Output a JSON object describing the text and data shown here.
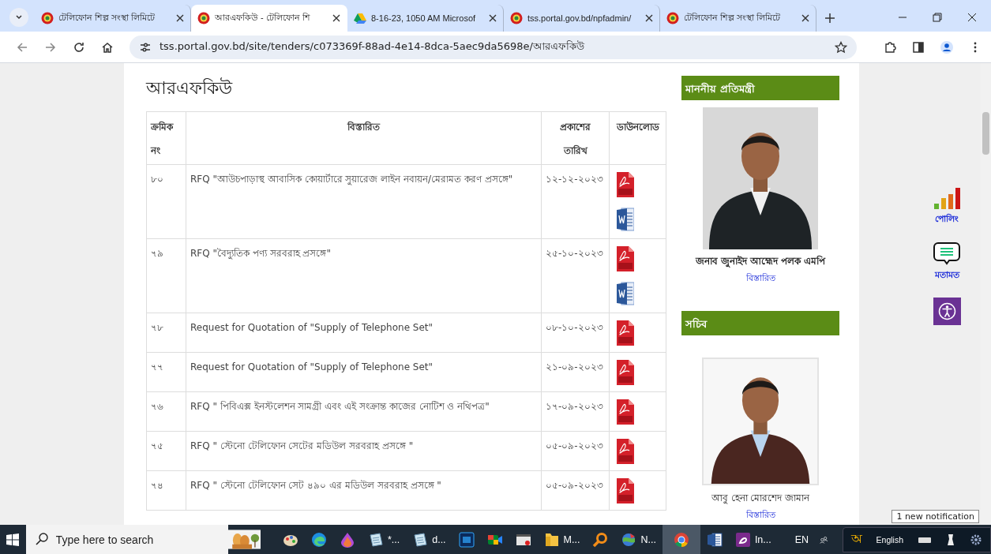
{
  "browser": {
    "tabs": [
      {
        "title": "টেলিফোন শিল্প সংস্থা লিমিটে",
        "kind": "emblem",
        "selected": false
      },
      {
        "title": "আরএফকিউ - টেলিফোন শি",
        "kind": "emblem",
        "selected": true
      },
      {
        "title": "8-16-23, 1050 AM Microsof",
        "kind": "drive",
        "selected": false
      },
      {
        "title": "tss.portal.gov.bd/npfadmin/",
        "kind": "emblem",
        "selected": false
      },
      {
        "title": "টেলিফোন শিল্প সংস্থা লিমিটে",
        "kind": "emblem",
        "selected": false
      }
    ],
    "url": "tss.portal.gov.bd/site/tenders/c073369f-88ad-4e14-8dca-5aec9da5698e/আরএফকিউ"
  },
  "page": {
    "heading": "আরএফকিউ",
    "table": {
      "columns": [
        {
          "lines": [
            "ক্রমিক",
            "নং"
          ]
        },
        {
          "lines": [
            "বিস্তারিত"
          ]
        },
        {
          "lines": [
            "প্রকাশের",
            "তারিখ"
          ]
        },
        {
          "lines": [
            "ডাউনলোড"
          ]
        }
      ],
      "rows": [
        {
          "no": "৮০",
          "details": "RFQ \"আউচপাড়াস্থ আবাসিক কোয়ার্টারে সুয়ারেজ লাইন নবায়ন/মেরামত করণ প্রসঙ্গে\"",
          "date": "১২-১২-২০২৩",
          "files": [
            {
              "kind": "pdf"
            },
            {
              "kind": "word"
            }
          ]
        },
        {
          "no": "৭৯",
          "details": "RFQ \"বৈদ্যুতিক পণ্য সরবরাহ প্রসঙ্গে\"",
          "date": "২৫-১০-২০২৩",
          "files": [
            {
              "kind": "pdf"
            },
            {
              "kind": "word"
            }
          ]
        },
        {
          "no": "৭৮",
          "details": "Request for Quotation of \"Supply of Telephone Set\"",
          "date": "০৮-১০-২০২৩",
          "files": [
            {
              "kind": "pdf"
            }
          ]
        },
        {
          "no": "৭৭",
          "details": "Request for Quotation of \"Supply of Telephone Set\"",
          "date": "২১-০৯-২০২৩",
          "files": [
            {
              "kind": "pdf"
            }
          ]
        },
        {
          "no": "৭৬",
          "details": "RFQ \"  পিবিএক্স ইনস্টলেশন সামগ্রী এবং এই  সংক্রান্ত  কাজের নোটিশ ও নথিপত্র\"",
          "date": "১৭-০৯-২০২৩",
          "files": [
            {
              "kind": "pdf"
            }
          ]
        },
        {
          "no": "৭৫",
          "details": "RFQ  \" স্টেনো টেলিফোন সেটের মডিউল সরবরাহ  প্রসঙ্গে \"",
          "date": "০৫-০৯-২০২৩",
          "files": [
            {
              "kind": "pdf"
            }
          ]
        },
        {
          "no": "৭৪",
          "details": "RFQ  \" স্টেনো টেলিফোন সেট ৪৯০ এর মডিউল সরবরাহ  প্রসঙ্গে \"",
          "date": "০৫-০৯-২০২৩",
          "files": [
            {
              "kind": "pdf"
            }
          ]
        }
      ]
    }
  },
  "sidebar": [
    {
      "heading": "মাননীয় প্রতিমন্ত্রী",
      "name": "জনাব জুনাইদ আহ্মেদ পলক এমপি",
      "link": "বিস্তারিত"
    },
    {
      "heading": "সচিব",
      "name": "আবু হেনা মোরশেদ জামান",
      "link": "বিস্তারিত"
    }
  ],
  "floating": [
    {
      "kind": "poll",
      "label": "পোলিং"
    },
    {
      "kind": "feedback",
      "label": "মতামত"
    },
    {
      "kind": "accessibility"
    }
  ],
  "notification": "1 new notification",
  "taskbar": {
    "search": {
      "placeholder": "Type here to search"
    },
    "apps": [
      {
        "kind": "paint",
        "selected": false
      },
      {
        "kind": "edge",
        "selected": false
      },
      {
        "kind": "drop",
        "selected": false
      },
      {
        "kind": "notepad",
        "label": "*...",
        "selected": false
      },
      {
        "kind": "notepad",
        "label": "d...",
        "selected": false
      },
      {
        "kind": "ps",
        "selected": false
      },
      {
        "kind": "meet",
        "selected": false
      },
      {
        "kind": "window",
        "selected": false
      },
      {
        "kind": "folder",
        "label": "M...",
        "selected": false
      },
      {
        "kind": "magnifier",
        "selected": false
      },
      {
        "kind": "globe",
        "label": "N...",
        "selected": false
      },
      {
        "kind": "chrome",
        "selected": true
      },
      {
        "kind": "word",
        "selected": false
      },
      {
        "kind": "pdf",
        "label": "In...",
        "selected": false
      }
    ],
    "language": "EN",
    "keyboard": {
      "letter": "অ",
      "layout": "English"
    }
  }
}
